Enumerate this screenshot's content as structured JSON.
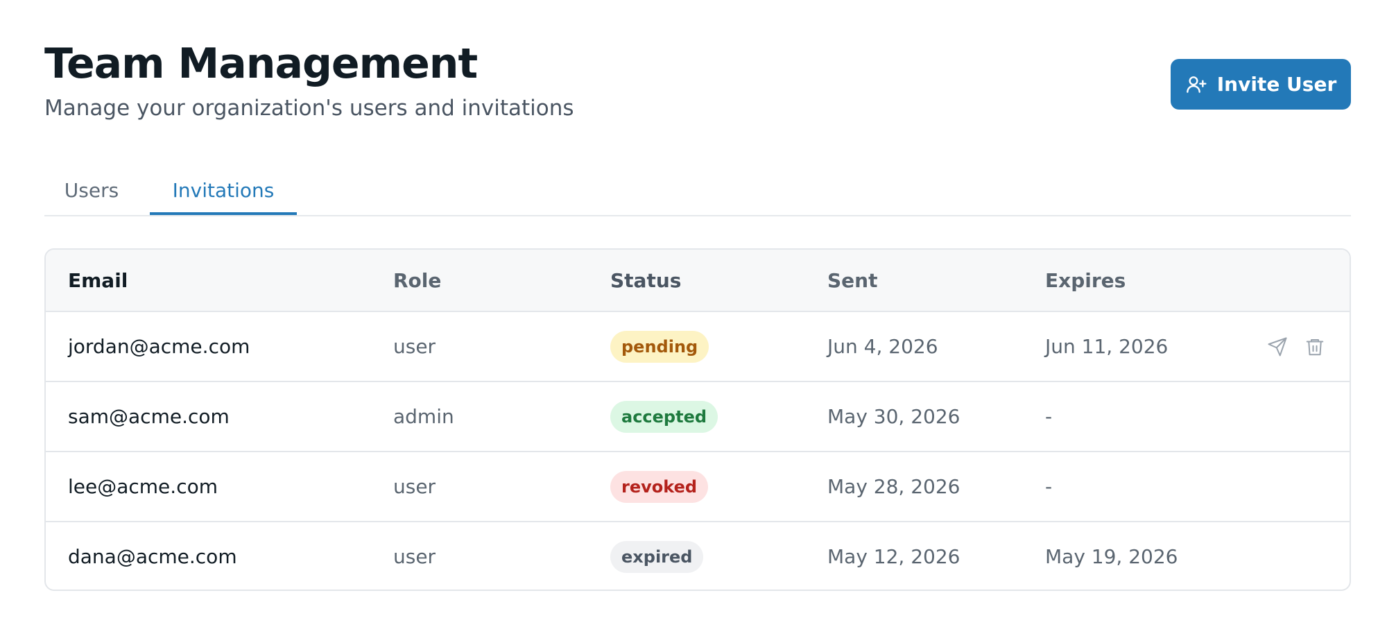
{
  "header": {
    "title": "Team Management",
    "subtitle": "Manage your organization's users and invitations",
    "invite_button_label": "Invite User",
    "invite_button_icon": "user-plus-icon"
  },
  "tabs": [
    {
      "label": "Users",
      "active": false
    },
    {
      "label": "Invitations",
      "active": true
    }
  ],
  "table": {
    "columns": [
      "Email",
      "Role",
      "Status",
      "Sent",
      "Expires"
    ],
    "rows": [
      {
        "email": "jordan@acme.com",
        "role": "user",
        "status": "pending",
        "sent": "Jun 4, 2026",
        "expires": "Jun 11, 2026",
        "actions": [
          "send-icon",
          "trash-icon"
        ]
      },
      {
        "email": "sam@acme.com",
        "role": "admin",
        "status": "accepted",
        "sent": "May 30, 2026",
        "expires": "-"
      },
      {
        "email": "lee@acme.com",
        "role": "user",
        "status": "revoked",
        "sent": "May 28, 2026",
        "expires": "-"
      },
      {
        "email": "dana@acme.com",
        "role": "user",
        "status": "expired",
        "sent": "May 12, 2026",
        "expires": "May 19, 2026"
      }
    ]
  },
  "colors": {
    "accent": "#2379b8",
    "pending_bg": "#fdf3c4",
    "pending_text": "#a3590b",
    "accepted_bg": "#dcf7e4",
    "accepted_text": "#1e7a3e",
    "revoked_bg": "#fde2e2",
    "revoked_text": "#b4221c",
    "expired_bg": "#f0f1f3",
    "expired_text": "#4a5562"
  }
}
